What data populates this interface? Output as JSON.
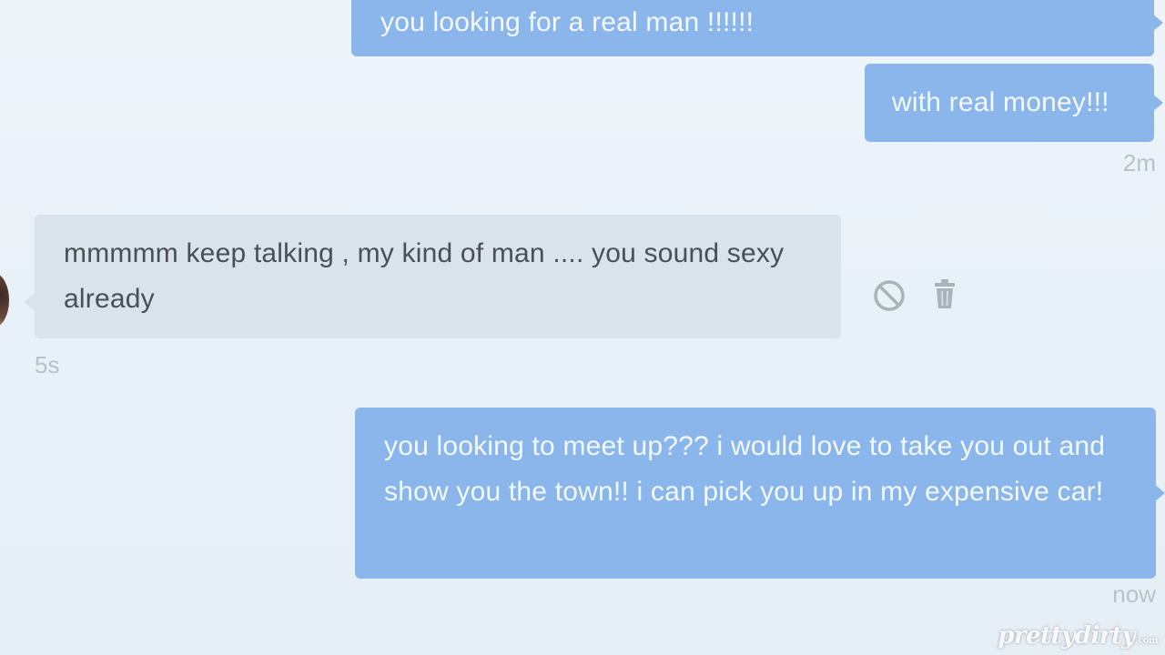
{
  "conversation": {
    "messages": [
      {
        "direction": "outgoing",
        "text": "you looking for a real man !!!!!!"
      },
      {
        "direction": "outgoing",
        "text": "with real money!!!",
        "time": "2m"
      },
      {
        "direction": "incoming",
        "text": "mmmmm keep talking , my kind of man .... you sound sexy already",
        "time": "5s"
      },
      {
        "direction": "outgoing",
        "text": "you looking to meet up??? i would love to take you out and show you the town!! i can pick you up in my expensive car!",
        "time": "now"
      }
    ]
  },
  "actions": {
    "block_icon": "block-icon",
    "delete_icon": "trash-icon"
  },
  "colors": {
    "outgoing_bubble": "#8ab6ec",
    "incoming_bubble": "#d9e3ec",
    "timestamp": "#b8c2cc"
  },
  "watermark": {
    "brand": "prettydirty",
    "suffix": ".com"
  }
}
